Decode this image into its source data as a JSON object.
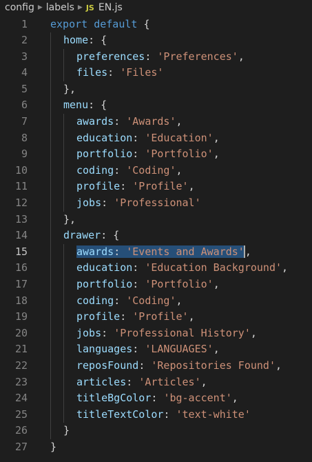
{
  "breadcrumb": {
    "items": [
      "config",
      "labels",
      "EN.js"
    ],
    "file_icon": "JS"
  },
  "editor": {
    "active_line": 15,
    "lines": [
      {
        "n": "1",
        "indent": 0,
        "tokens": [
          {
            "c": "k",
            "t": "export default "
          },
          {
            "c": "t",
            "t": "{"
          }
        ]
      },
      {
        "n": "2",
        "indent": 1,
        "tokens": [
          {
            "c": "p",
            "t": "home"
          },
          {
            "c": "t",
            "t": ": {"
          }
        ]
      },
      {
        "n": "3",
        "indent": 2,
        "tokens": [
          {
            "c": "p",
            "t": "preferences"
          },
          {
            "c": "t",
            "t": ": "
          },
          {
            "c": "s",
            "t": "'Preferences'"
          },
          {
            "c": "t",
            "t": ","
          }
        ]
      },
      {
        "n": "4",
        "indent": 2,
        "tokens": [
          {
            "c": "p",
            "t": "files"
          },
          {
            "c": "t",
            "t": ": "
          },
          {
            "c": "s",
            "t": "'Files'"
          }
        ]
      },
      {
        "n": "5",
        "indent": 1,
        "tokens": [
          {
            "c": "t",
            "t": "},"
          }
        ]
      },
      {
        "n": "6",
        "indent": 1,
        "tokens": [
          {
            "c": "p",
            "t": "menu"
          },
          {
            "c": "t",
            "t": ": {"
          }
        ]
      },
      {
        "n": "7",
        "indent": 2,
        "tokens": [
          {
            "c": "p",
            "t": "awards"
          },
          {
            "c": "t",
            "t": ": "
          },
          {
            "c": "s",
            "t": "'Awards'"
          },
          {
            "c": "t",
            "t": ","
          }
        ]
      },
      {
        "n": "8",
        "indent": 2,
        "tokens": [
          {
            "c": "p",
            "t": "education"
          },
          {
            "c": "t",
            "t": ": "
          },
          {
            "c": "s",
            "t": "'Education'"
          },
          {
            "c": "t",
            "t": ","
          }
        ]
      },
      {
        "n": "9",
        "indent": 2,
        "tokens": [
          {
            "c": "p",
            "t": "portfolio"
          },
          {
            "c": "t",
            "t": ": "
          },
          {
            "c": "s",
            "t": "'Portfolio'"
          },
          {
            "c": "t",
            "t": ","
          }
        ]
      },
      {
        "n": "10",
        "indent": 2,
        "tokens": [
          {
            "c": "p",
            "t": "coding"
          },
          {
            "c": "t",
            "t": ": "
          },
          {
            "c": "s",
            "t": "'Coding'"
          },
          {
            "c": "t",
            "t": ","
          }
        ]
      },
      {
        "n": "11",
        "indent": 2,
        "tokens": [
          {
            "c": "p",
            "t": "profile"
          },
          {
            "c": "t",
            "t": ": "
          },
          {
            "c": "s",
            "t": "'Profile'"
          },
          {
            "c": "t",
            "t": ","
          }
        ]
      },
      {
        "n": "12",
        "indent": 2,
        "tokens": [
          {
            "c": "p",
            "t": "jobs"
          },
          {
            "c": "t",
            "t": ": "
          },
          {
            "c": "s",
            "t": "'Professional'"
          }
        ]
      },
      {
        "n": "13",
        "indent": 1,
        "tokens": [
          {
            "c": "t",
            "t": "},"
          }
        ]
      },
      {
        "n": "14",
        "indent": 1,
        "tokens": [
          {
            "c": "p",
            "t": "drawer"
          },
          {
            "c": "t",
            "t": ": {"
          }
        ]
      },
      {
        "n": "15",
        "indent": 2,
        "tokens": [
          {
            "c": "p",
            "t": "awards",
            "sel": true
          },
          {
            "c": "t",
            "t": ": ",
            "sel": true
          },
          {
            "c": "s",
            "t": "'Events and Awards'",
            "sel": true
          },
          {
            "c": "t",
            "t": ",",
            "cursor": true
          }
        ]
      },
      {
        "n": "16",
        "indent": 2,
        "tokens": [
          {
            "c": "p",
            "t": "education"
          },
          {
            "c": "t",
            "t": ": "
          },
          {
            "c": "s",
            "t": "'Education Background'"
          },
          {
            "c": "t",
            "t": ","
          }
        ]
      },
      {
        "n": "17",
        "indent": 2,
        "tokens": [
          {
            "c": "p",
            "t": "portfolio"
          },
          {
            "c": "t",
            "t": ": "
          },
          {
            "c": "s",
            "t": "'Portfolio'"
          },
          {
            "c": "t",
            "t": ","
          }
        ]
      },
      {
        "n": "18",
        "indent": 2,
        "tokens": [
          {
            "c": "p",
            "t": "coding"
          },
          {
            "c": "t",
            "t": ": "
          },
          {
            "c": "s",
            "t": "'Coding'"
          },
          {
            "c": "t",
            "t": ","
          }
        ]
      },
      {
        "n": "19",
        "indent": 2,
        "tokens": [
          {
            "c": "p",
            "t": "profile"
          },
          {
            "c": "t",
            "t": ": "
          },
          {
            "c": "s",
            "t": "'Profile'"
          },
          {
            "c": "t",
            "t": ","
          }
        ]
      },
      {
        "n": "20",
        "indent": 2,
        "tokens": [
          {
            "c": "p",
            "t": "jobs"
          },
          {
            "c": "t",
            "t": ": "
          },
          {
            "c": "s",
            "t": "'Professional History'"
          },
          {
            "c": "t",
            "t": ","
          }
        ]
      },
      {
        "n": "21",
        "indent": 2,
        "tokens": [
          {
            "c": "p",
            "t": "languages"
          },
          {
            "c": "t",
            "t": ": "
          },
          {
            "c": "s",
            "t": "'LANGUAGES'"
          },
          {
            "c": "t",
            "t": ","
          }
        ]
      },
      {
        "n": "22",
        "indent": 2,
        "tokens": [
          {
            "c": "p",
            "t": "reposFound"
          },
          {
            "c": "t",
            "t": ": "
          },
          {
            "c": "s",
            "t": "'Repositories Found'"
          },
          {
            "c": "t",
            "t": ","
          }
        ]
      },
      {
        "n": "23",
        "indent": 2,
        "tokens": [
          {
            "c": "p",
            "t": "articles"
          },
          {
            "c": "t",
            "t": ": "
          },
          {
            "c": "s",
            "t": "'Articles'"
          },
          {
            "c": "t",
            "t": ","
          }
        ]
      },
      {
        "n": "24",
        "indent": 2,
        "tokens": [
          {
            "c": "p",
            "t": "titleBgColor"
          },
          {
            "c": "t",
            "t": ": "
          },
          {
            "c": "s",
            "t": "'bg-accent'"
          },
          {
            "c": "t",
            "t": ","
          }
        ]
      },
      {
        "n": "25",
        "indent": 2,
        "tokens": [
          {
            "c": "p",
            "t": "titleTextColor"
          },
          {
            "c": "t",
            "t": ": "
          },
          {
            "c": "s",
            "t": "'text-white'"
          }
        ]
      },
      {
        "n": "26",
        "indent": 1,
        "tokens": [
          {
            "c": "t",
            "t": "}"
          }
        ]
      },
      {
        "n": "27",
        "indent": 0,
        "tokens": [
          {
            "c": "t",
            "t": "}"
          }
        ]
      }
    ]
  },
  "colors": {
    "background": "#1e1e1e",
    "keyword": "#569cd6",
    "property": "#9cdcfe",
    "string": "#ce9178",
    "selection": "#264f78",
    "line_number": "#858585"
  }
}
